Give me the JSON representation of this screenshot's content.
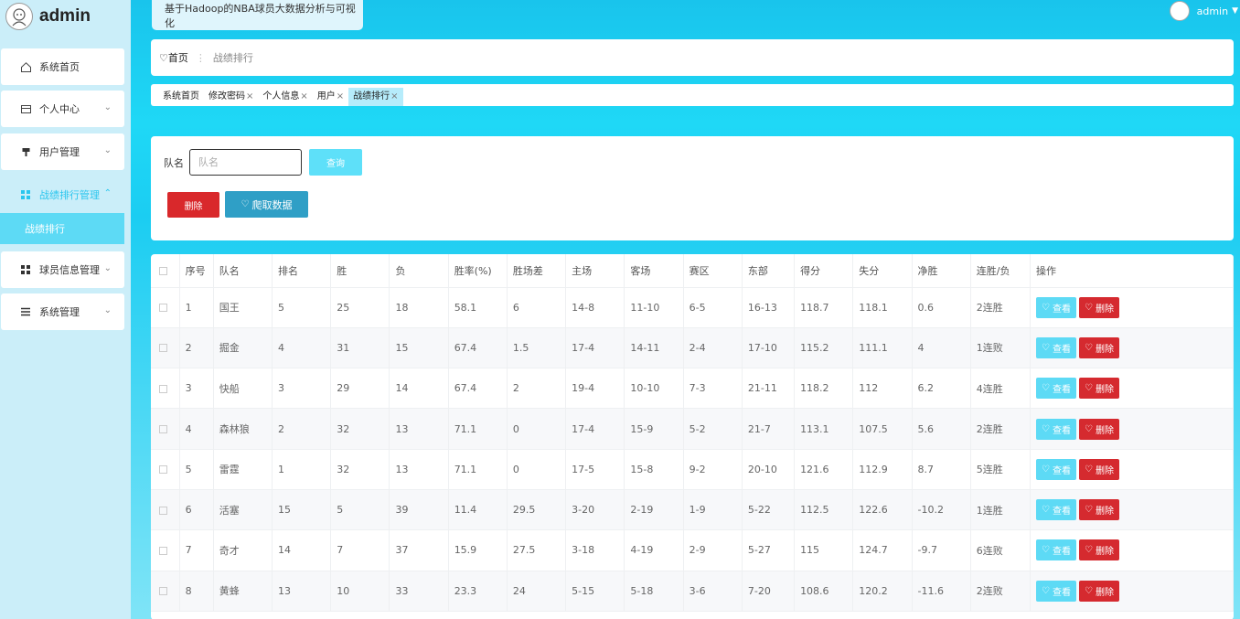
{
  "brand": {
    "name": "admin"
  },
  "app_title": "基于Hadoop的NBA球员大数据分析与可视化",
  "user": {
    "name": "admin"
  },
  "sidebar": {
    "items": [
      {
        "label": "系统首页",
        "icon": "home-icon"
      },
      {
        "label": "个人中心",
        "icon": "card-icon"
      },
      {
        "label": "用户管理",
        "icon": "pin-icon"
      },
      {
        "label": "战绩排行管理",
        "icon": "grid-icon"
      },
      {
        "label": "球员信息管理",
        "icon": "grid-icon"
      },
      {
        "label": "系统管理",
        "icon": "list-icon"
      }
    ],
    "submenu": {
      "label": "战绩排行"
    }
  },
  "breadcrumb": {
    "home": "首页",
    "current": "战绩排行"
  },
  "tabs": [
    {
      "label": "系统首页"
    },
    {
      "label": "修改密码"
    },
    {
      "label": "个人信息"
    },
    {
      "label": "用户"
    },
    {
      "label": "战绩排行"
    }
  ],
  "search": {
    "label": "队名",
    "placeholder": "队名",
    "query_label": "查询",
    "delete_label": "删除",
    "crawl_label": "爬取数据"
  },
  "table": {
    "headers": [
      "序号",
      "队名",
      "排名",
      "胜",
      "负",
      "胜率(%)",
      "胜场差",
      "主场",
      "客场",
      "赛区",
      "东部",
      "得分",
      "失分",
      "净胜",
      "连胜/负",
      "操作"
    ],
    "view_label": "查看",
    "delete_label": "删除",
    "rows": [
      [
        "1",
        "国王",
        "5",
        "25",
        "18",
        "58.1",
        "6",
        "14-8",
        "11-10",
        "6-5",
        "16-13",
        "118.7",
        "118.1",
        "0.6",
        "2连胜"
      ],
      [
        "2",
        "掘金",
        "4",
        "31",
        "15",
        "67.4",
        "1.5",
        "17-4",
        "14-11",
        "2-4",
        "17-10",
        "115.2",
        "111.1",
        "4",
        "1连败"
      ],
      [
        "3",
        "快船",
        "3",
        "29",
        "14",
        "67.4",
        "2",
        "19-4",
        "10-10",
        "7-3",
        "21-11",
        "118.2",
        "112",
        "6.2",
        "4连胜"
      ],
      [
        "4",
        "森林狼",
        "2",
        "32",
        "13",
        "71.1",
        "0",
        "17-4",
        "15-9",
        "5-2",
        "21-7",
        "113.1",
        "107.5",
        "5.6",
        "2连胜"
      ],
      [
        "5",
        "雷霆",
        "1",
        "32",
        "13",
        "71.1",
        "0",
        "17-5",
        "15-8",
        "9-2",
        "20-10",
        "121.6",
        "112.9",
        "8.7",
        "5连胜"
      ],
      [
        "6",
        "活塞",
        "15",
        "5",
        "39",
        "11.4",
        "29.5",
        "3-20",
        "2-19",
        "1-9",
        "5-22",
        "112.5",
        "122.6",
        "-10.2",
        "1连胜"
      ],
      [
        "7",
        "奇才",
        "14",
        "7",
        "37",
        "15.9",
        "27.5",
        "3-18",
        "4-19",
        "2-9",
        "5-27",
        "115",
        "124.7",
        "-9.7",
        "6连败"
      ],
      [
        "8",
        "黄蜂",
        "13",
        "10",
        "33",
        "23.3",
        "24",
        "5-15",
        "5-18",
        "3-6",
        "7-20",
        "108.6",
        "120.2",
        "-11.6",
        "2连败"
      ]
    ]
  }
}
